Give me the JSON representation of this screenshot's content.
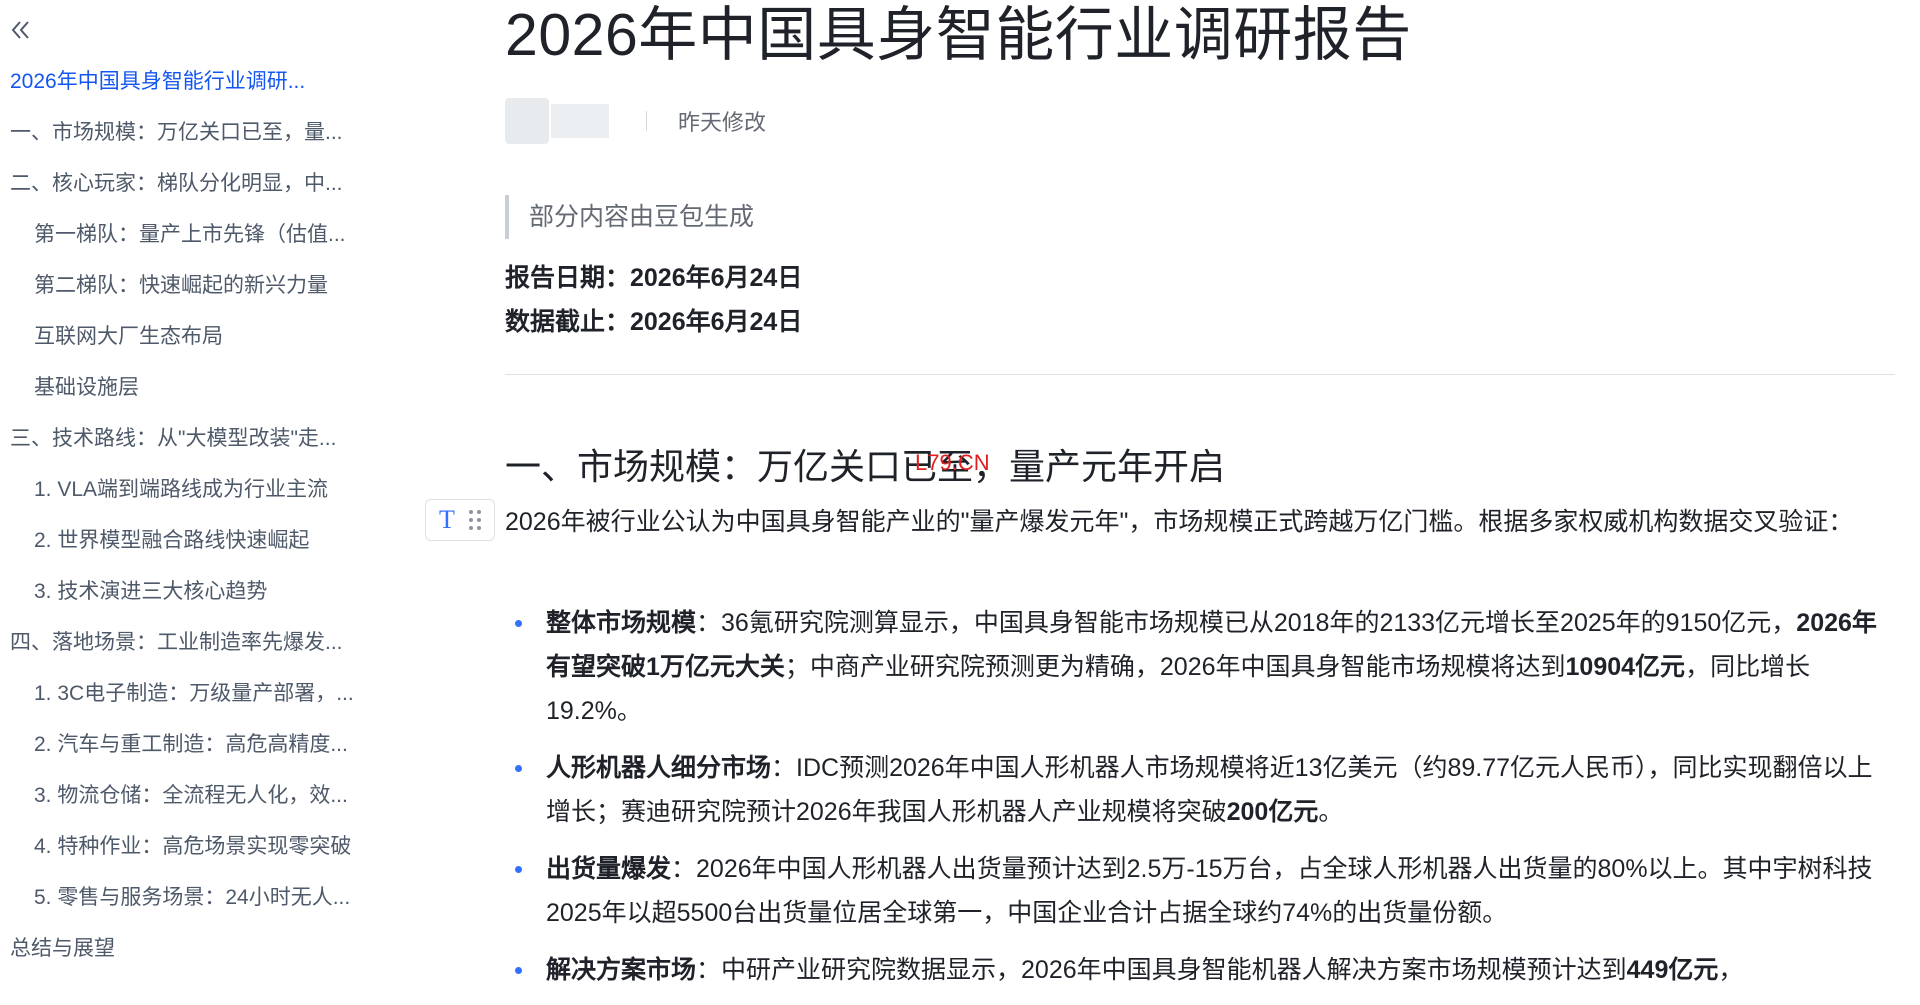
{
  "sidebar": {
    "collapse_icon": "double-chevron-left-icon",
    "toc": [
      {
        "label": "2026年中国具身智能行业调研...",
        "level": 0,
        "active": true
      },
      {
        "label": "一、市场规模：万亿关口已至，量...",
        "level": 0
      },
      {
        "label": "二、核心玩家：梯队分化明显，中...",
        "level": 0
      },
      {
        "label": "第一梯队：量产上市先锋（估值...",
        "level": 1
      },
      {
        "label": "第二梯队：快速崛起的新兴力量",
        "level": 1
      },
      {
        "label": "互联网大厂生态布局",
        "level": 1
      },
      {
        "label": "基础设施层",
        "level": 1
      },
      {
        "label": "三、技术路线：从\"大模型改装\"走...",
        "level": 0
      },
      {
        "label": "1. VLA端到端路线成为行业主流",
        "level": 1
      },
      {
        "label": "2. 世界模型融合路线快速崛起",
        "level": 1
      },
      {
        "label": "3. 技术演进三大核心趋势",
        "level": 1
      },
      {
        "label": "四、落地场景：工业制造率先爆发...",
        "level": 0
      },
      {
        "label": "1. 3C电子制造：万级量产部署，...",
        "level": 1
      },
      {
        "label": "2. 汽车与重工制造：高危高精度...",
        "level": 1
      },
      {
        "label": "3. 物流仓储：全流程无人化，效...",
        "level": 1
      },
      {
        "label": "4. 特种作业：高危场景实现零突破",
        "level": 1
      },
      {
        "label": "5. 零售与服务场景：24小时无人...",
        "level": 1
      },
      {
        "label": "总结与展望",
        "level": 0
      }
    ]
  },
  "doc": {
    "title": "2026年中国具身智能行业调研报告",
    "modified": "昨天修改",
    "quote": "部分内容由豆包生成",
    "report_date": "报告日期：2026年6月24日",
    "data_cutoff": "数据截止：2026年6月24日",
    "section1_heading": "一、市场规模：万亿关口已至，量产元年开启",
    "watermark": "L79.CN",
    "intro": "2026年被行业公认为中国具身智能产业的\"量产爆发元年\"，市场规模正式跨越万亿门槛。根据多家权威机构数据交叉验证：",
    "bullets": [
      {
        "segments": [
          {
            "text": "整体市场规模",
            "bold": true
          },
          {
            "text": "：36氪研究院测算显示，中国具身智能市场规模已从2018年的2133亿元增长至2025年的9150亿元，"
          },
          {
            "text": "2026年有望突破1万亿元大关",
            "bold": true
          },
          {
            "text": "；中商产业研究院预测更为精确，2026年中国具身智能市场规模将达到"
          },
          {
            "text": "10904亿元",
            "bold": true
          },
          {
            "text": "，同比增长19.2%。"
          }
        ]
      },
      {
        "segments": [
          {
            "text": "人形机器人细分市场",
            "bold": true
          },
          {
            "text": "：IDC预测2026年中国人形机器人市场规模将近13亿美元（约89.77亿元人民币），同比实现翻倍以上增长；赛迪研究院预计2026年我国人形机器人产业规模将突破"
          },
          {
            "text": "200亿元",
            "bold": true
          },
          {
            "text": "。"
          }
        ]
      },
      {
        "segments": [
          {
            "text": "出货量爆发",
            "bold": true
          },
          {
            "text": "：2026年中国人形机器人出货量预计达到2.5万-15万台，占全球人形机器人出货量的80%以上。其中宇树科技2025年以超5500台出货量位居全球第一，中国企业合计占据全球约74%的出货量份额。"
          }
        ]
      },
      {
        "segments": [
          {
            "text": "解决方案市场",
            "bold": true
          },
          {
            "text": "：中研产业研究院数据显示，2026年中国具身智能机器人解决方案市场规模预计达到"
          },
          {
            "text": "449亿元",
            "bold": true
          },
          {
            "text": "，"
          }
        ]
      }
    ]
  },
  "colors": {
    "accent": "#3370ff",
    "active_toc": "#1456f0",
    "text": "#1f2329",
    "muted": "#646a73",
    "watermark": "#e02020"
  }
}
